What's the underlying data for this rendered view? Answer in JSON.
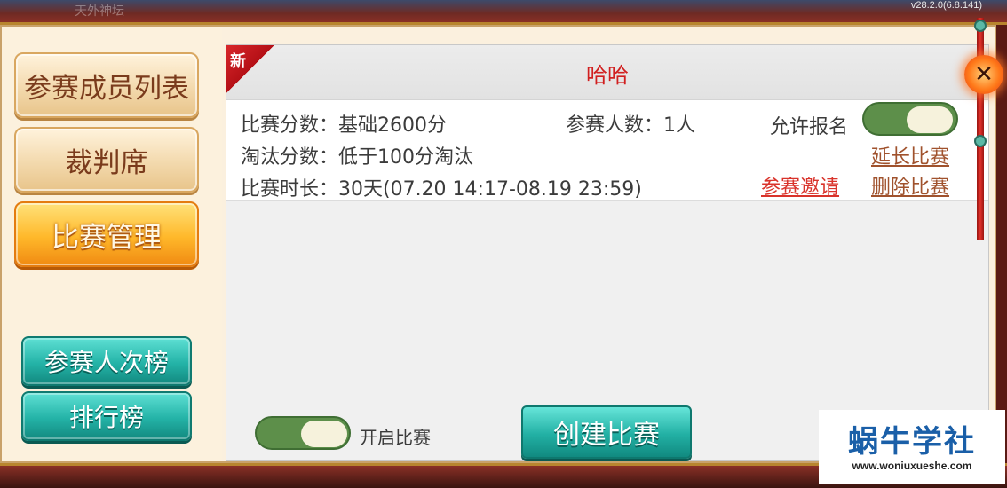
{
  "top_bar": {
    "faded_name": "天外神坛",
    "version": "v28.2.0(6.8.141)"
  },
  "sidebar": {
    "items": [
      {
        "label": "参赛成员列表",
        "active": false
      },
      {
        "label": "裁判席",
        "active": false
      },
      {
        "label": "比赛管理",
        "active": true
      }
    ],
    "bottom_buttons": [
      {
        "label": "参赛人次榜"
      },
      {
        "label": "排行榜"
      }
    ]
  },
  "match_card": {
    "badge": "新",
    "title": "哈哈",
    "score_label": "比赛分数：基础2600分",
    "participants_label": "参赛人数：1人",
    "elimination_label": "淘汰分数：低于100分淘汰",
    "duration_label": "比赛时长：30天(07.20 14:17-08.19 23:59)",
    "allow_signup_label": "允许报名",
    "allow_signup_on": true,
    "extend_label": "延长比赛",
    "invite_label": "参赛邀请",
    "delete_label": "删除比赛"
  },
  "footer": {
    "open_match_label": "开启比赛",
    "open_match_on": true,
    "create_label": "创建比赛"
  },
  "close_icon": "close-icon",
  "watermark": {
    "title": "蜗牛学社",
    "url": "www.woniuxueshe.com"
  },
  "colors": {
    "accent_red": "#d11f1f",
    "link_red": "#d9332b",
    "link_brown": "#a0522d",
    "toggle_green": "#5d8f4a",
    "teal": "#22b0a4",
    "active_orange": "#ffb82a"
  }
}
